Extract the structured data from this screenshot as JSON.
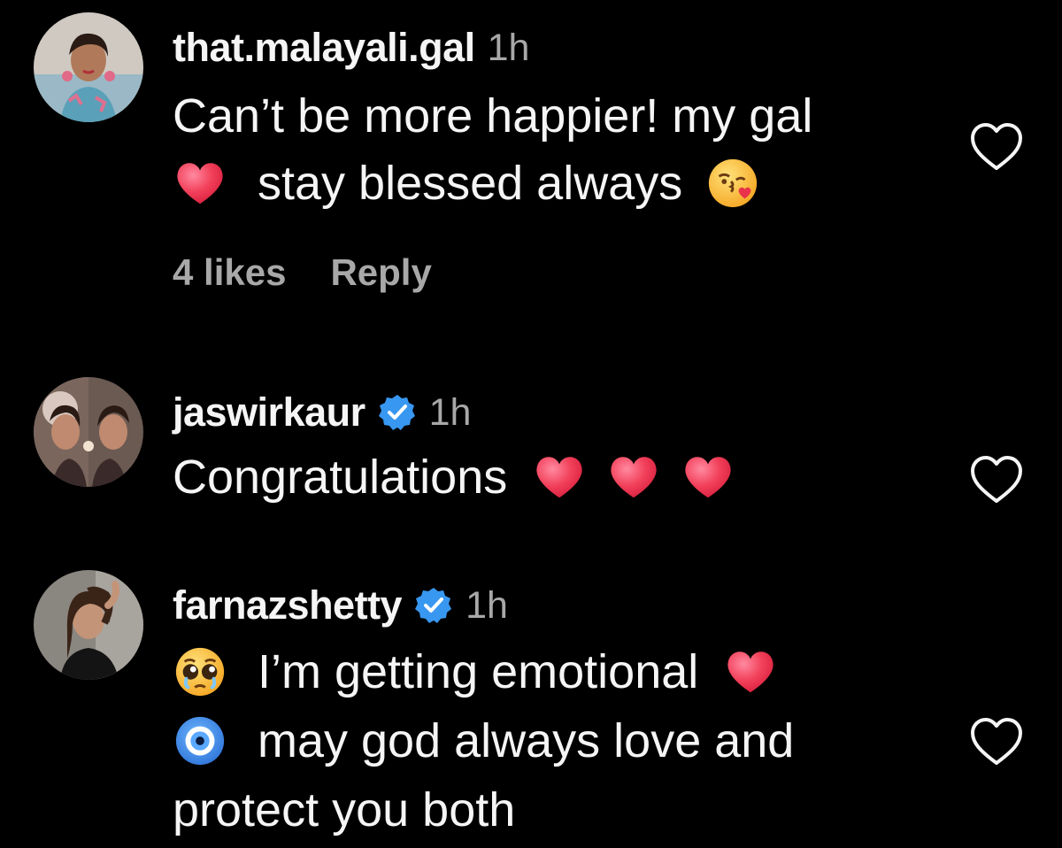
{
  "comments": [
    {
      "username": "that.malayali.gal",
      "verified": false,
      "time": "1h",
      "line1": "Can’t be more happier! my gal",
      "line2": "stay blessed always",
      "likes": "4 likes",
      "reply": "Reply"
    },
    {
      "username": "jaswirkaur",
      "verified": true,
      "time": "1h",
      "line1": "Congratulations"
    },
    {
      "username": "farnazshetty",
      "verified": true,
      "time": "1h",
      "line1": "I’m getting emotional",
      "line2": "may god always love and",
      "line3": "protect you both"
    }
  ],
  "icons": {
    "like": "heart-outline-icon",
    "verified": "verified-badge-icon",
    "heart_emoji": "red-heart-emoji",
    "kiss_emoji": "face-blowing-kiss-emoji",
    "pleading_emoji": "pleading-face-emoji",
    "nazar_emoji": "nazar-amulet-emoji"
  },
  "colors": {
    "background": "#000000",
    "primary_text": "#f5f5f5",
    "secondary_text": "#a8a8a8",
    "verified_blue": "#3897f0",
    "heart": "#e8334a"
  }
}
